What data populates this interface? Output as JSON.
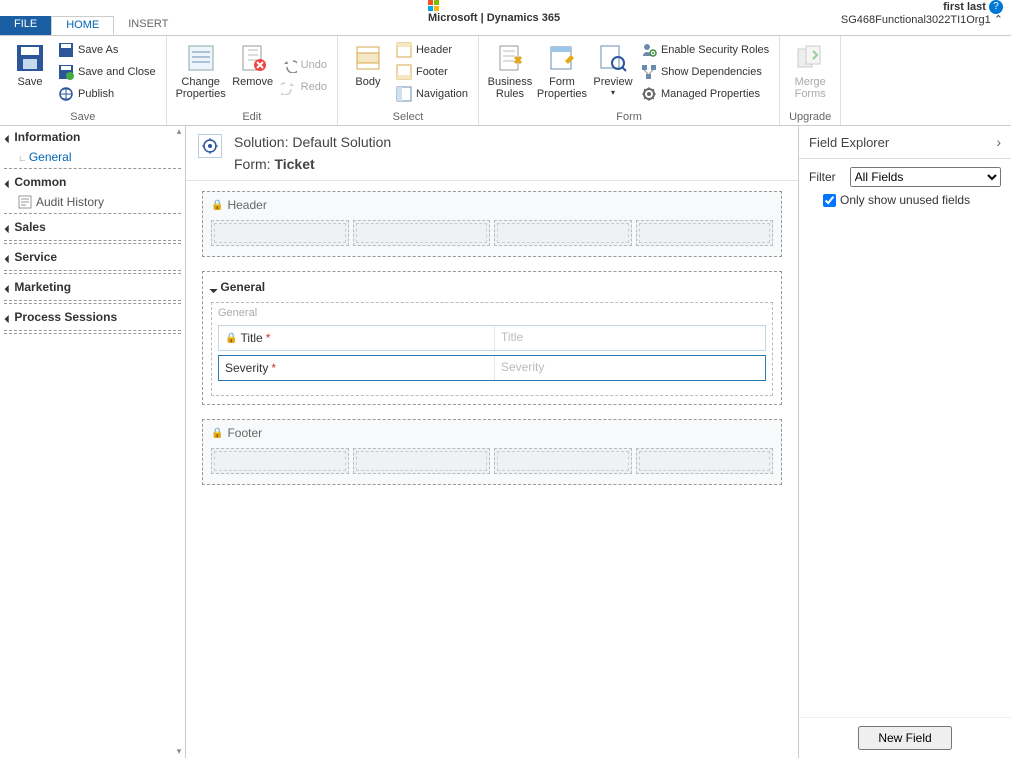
{
  "brand": {
    "ms": "Microsoft",
    "sep": "|",
    "dyn": "Dynamics 365"
  },
  "user": {
    "name": "first last",
    "org": "SG468Functional3022TI1Org1"
  },
  "tabs": {
    "file": "FILE",
    "home": "HOME",
    "insert": "INSERT"
  },
  "ribbon": {
    "save": {
      "save": "Save",
      "save_as": "Save As",
      "save_close": "Save and Close",
      "publish": "Publish",
      "group": "Save"
    },
    "edit": {
      "change_props": "Change\nProperties",
      "remove": "Remove",
      "undo": "Undo",
      "redo": "Redo",
      "group": "Edit"
    },
    "select": {
      "body": "Body",
      "header": "Header",
      "footer": "Footer",
      "navigation": "Navigation",
      "group": "Select"
    },
    "form": {
      "biz_rules": "Business\nRules",
      "form_props": "Form\nProperties",
      "preview": "Preview",
      "preview_arrow": "▾",
      "sec_roles": "Enable Security Roles",
      "show_deps": "Show Dependencies",
      "managed_props": "Managed Properties",
      "group": "Form"
    },
    "upgrade": {
      "merge_forms": "Merge\nForms",
      "group": "Upgrade"
    }
  },
  "leftnav": {
    "information": "Information",
    "general": "General",
    "common": "Common",
    "audit": "Audit History",
    "sales": "Sales",
    "service": "Service",
    "marketing": "Marketing",
    "process": "Process Sessions"
  },
  "canvas": {
    "solution_lbl": "Solution: ",
    "solution": "Default Solution",
    "form_lbl": "Form: ",
    "form_name": "Ticket",
    "header": "Header",
    "footer": "Footer",
    "tab_general": "General",
    "sec_general": "General",
    "title_lbl": "Title",
    "title_ph": "Title",
    "severity_lbl": "Severity",
    "severity_ph": "Severity"
  },
  "explorer": {
    "title": "Field Explorer",
    "filter_lbl": "Filter",
    "filter_val": "All Fields",
    "only_unused": "Only show unused fields",
    "new_field": "New Field"
  }
}
